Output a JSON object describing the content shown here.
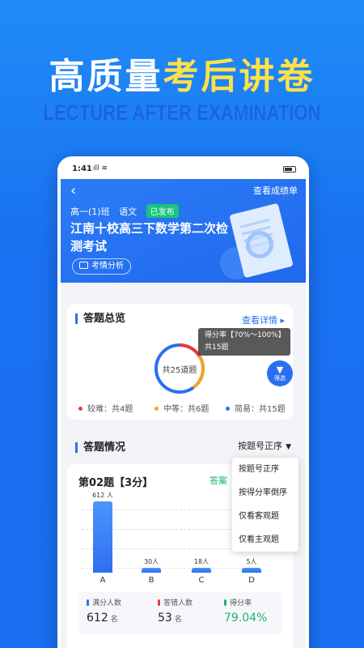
{
  "promo": {
    "title_main": "高质量",
    "title_highlight": "考后讲卷",
    "subtitle": "LECTURE AFTER EXAMINATION"
  },
  "status_bar": {
    "time": "1:41",
    "signal": "ıll  ≋"
  },
  "header": {
    "back_icon": "chevron-left-icon",
    "report_link": "查看成绩单",
    "class_name": "高一(1)班",
    "subject": "语文",
    "status_badge": "已发布",
    "exam_title": "江南十校高三下数学第二次检测考试",
    "analysis_button": "考情分析"
  },
  "overview": {
    "section_title": "答题总览",
    "detail_link": "查看详情 ▸",
    "donut_label": "共25道题",
    "tooltip_line1": "得分率【70%～100%】",
    "tooltip_line2": "共15题",
    "filter_label": "筛选",
    "legend": [
      {
        "label": "较难：共4题",
        "color": "#e83b3b",
        "count": 4
      },
      {
        "label": "中等：共6题",
        "color": "#f5a623",
        "count": 6
      },
      {
        "label": "简易：共15题",
        "color": "#2a6ff3",
        "count": 15
      }
    ]
  },
  "answers": {
    "section_title": "答题情况",
    "sort_label": "按题号正序",
    "question_title": "第02题【3分】",
    "answer_label": "答案",
    "chart_data": {
      "type": "bar",
      "categories": [
        "A",
        "B",
        "C",
        "D"
      ],
      "values": [
        612,
        30,
        18,
        5
      ],
      "value_labels": [
        "612 人",
        "30人",
        "18人",
        "5人"
      ],
      "ylim": [
        0,
        700
      ]
    },
    "stats": [
      {
        "label": "满分人数",
        "value": "612",
        "unit": "名",
        "color": "#2a6ff3"
      },
      {
        "label": "答错人数",
        "value": "53",
        "unit": "名",
        "color": "#e83b3b"
      },
      {
        "label": "得分率",
        "value": "79.04%",
        "unit": "",
        "color": "#19b46b"
      }
    ]
  },
  "sort_menu": [
    "按题号正序",
    "按得分率倒序",
    "仅看客观题",
    "仅看主观题"
  ]
}
